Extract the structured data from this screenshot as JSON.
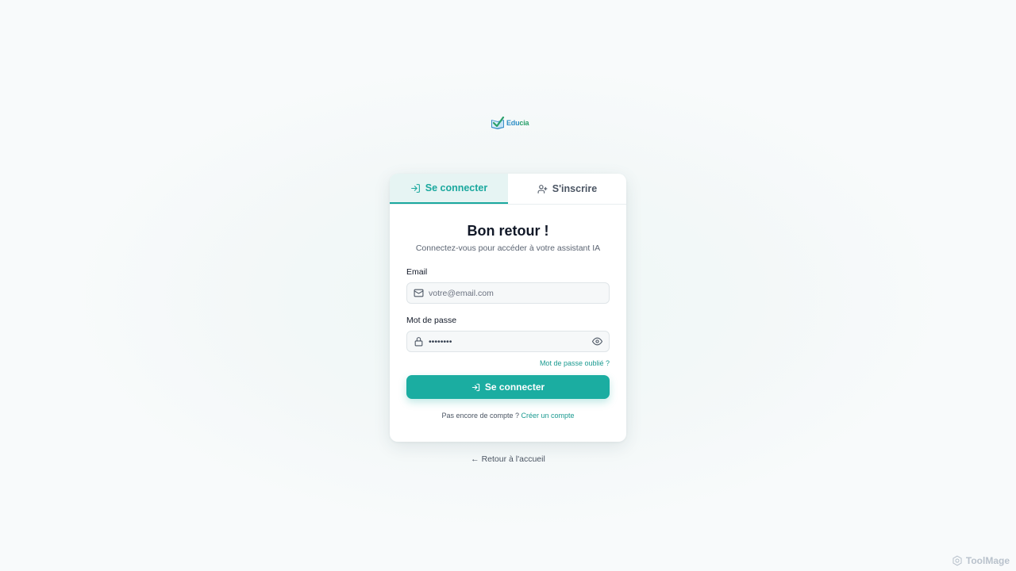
{
  "brand": {
    "name_part1": "Edu",
    "name_part2": "cia"
  },
  "tabs": [
    {
      "label": "Se connecter",
      "icon": "login-icon",
      "active": true
    },
    {
      "label": "S'inscrire",
      "icon": "user-plus-icon",
      "active": false
    }
  ],
  "form": {
    "title": "Bon retour !",
    "subtitle": "Connectez-vous pour accéder à votre assistant IA",
    "email_label": "Email",
    "email_placeholder": "votre@email.com",
    "email_value": "",
    "password_label": "Mot de passe",
    "password_value": "password",
    "forgot_link": "Mot de passe oublié ?",
    "submit_label": "Se connecter",
    "no_account_text": "Pas encore de compte ?",
    "create_account_link": "Créer un compte"
  },
  "back_link": "← Retour à l'accueil",
  "watermark": "ToolMage",
  "colors": {
    "accent": "#1bada1",
    "accent_light": "#e6f4f3",
    "logo_green": "#2aa06b",
    "logo_blue": "#2f8fc7"
  }
}
